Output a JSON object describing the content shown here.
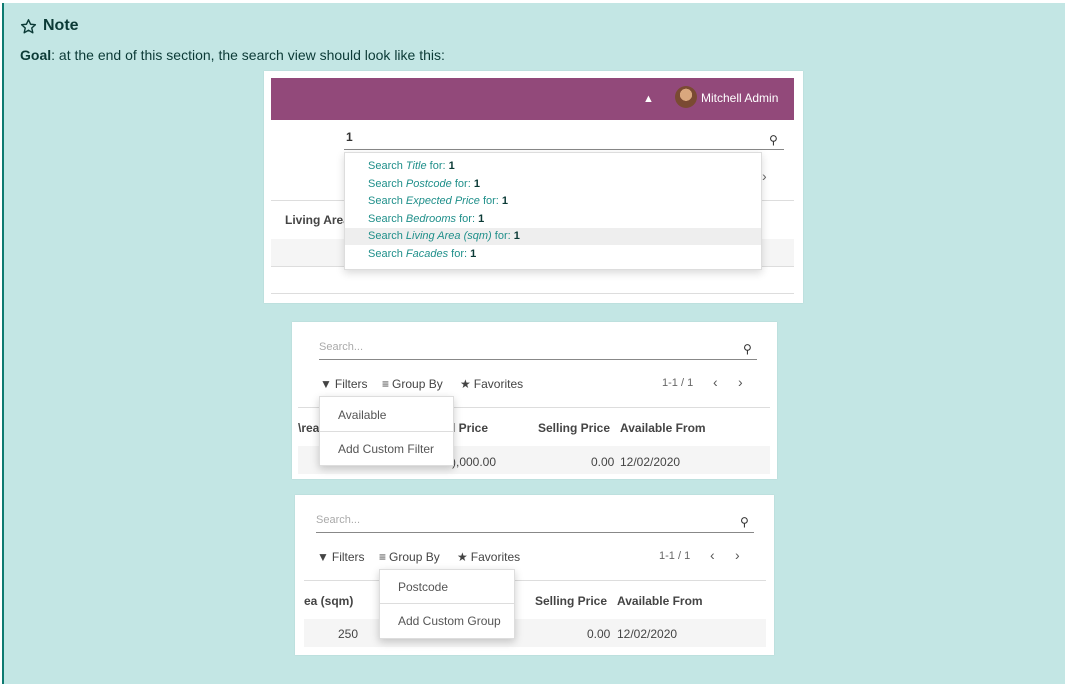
{
  "note": {
    "title": "Note",
    "goal_bold": "Goal",
    "goal_text": ": at the end of this section, the search view should look like this:"
  },
  "shot1": {
    "user_name": "Mitchell Admin",
    "query": "1",
    "column_header": "Living Area",
    "suggestions": [
      {
        "prefix": "Search ",
        "field": "Title",
        "suffix": " for: ",
        "value": "1"
      },
      {
        "prefix": "Search ",
        "field": "Postcode",
        "suffix": " for: ",
        "value": "1"
      },
      {
        "prefix": "Search ",
        "field": "Expected Price",
        "suffix": " for: ",
        "value": "1"
      },
      {
        "prefix": "Search ",
        "field": "Bedrooms",
        "suffix": " for: ",
        "value": "1"
      },
      {
        "prefix": "Search ",
        "field": "Living Area (sqm)",
        "suffix": " for: ",
        "value": "1"
      },
      {
        "prefix": "Search ",
        "field": "Facades",
        "suffix": " for: ",
        "value": "1"
      }
    ]
  },
  "shot2": {
    "placeholder": "Search...",
    "filters": "Filters",
    "group_by": "Group By",
    "favorites": "Favorites",
    "pager": "1-1 / 1",
    "col_partial_left": "\\rea",
    "col_partial_price": "l Price",
    "col_selling": "Selling Price",
    "col_available": "Available From",
    "cell_partial": "),000.00",
    "cell_selling": "0.00",
    "cell_date": "12/02/2020",
    "menu": [
      "Available",
      "Add Custom Filter"
    ]
  },
  "shot3": {
    "placeholder": "Search...",
    "filters": "Filters",
    "group_by": "Group By",
    "favorites": "Favorites",
    "pager": "1-1 / 1",
    "col_partial_left": "ea (sqm)",
    "col_selling": "Selling Price",
    "col_available": "Available From",
    "cell_area": "250",
    "cell_selling": "0.00",
    "cell_date": "12/02/2020",
    "menu": [
      "Postcode",
      "Add Custom Group"
    ]
  },
  "colors": {
    "note_bg": "#c3e6e4",
    "note_border": "#0d7a70",
    "navbar": "#92497a",
    "link": "#1f8f8a"
  },
  "icons": [
    "star-outline-icon",
    "gift-icon",
    "avatar",
    "search-icon",
    "filter-icon",
    "group-by-icon",
    "star-icon",
    "chevron-left-icon",
    "chevron-right-icon"
  ]
}
